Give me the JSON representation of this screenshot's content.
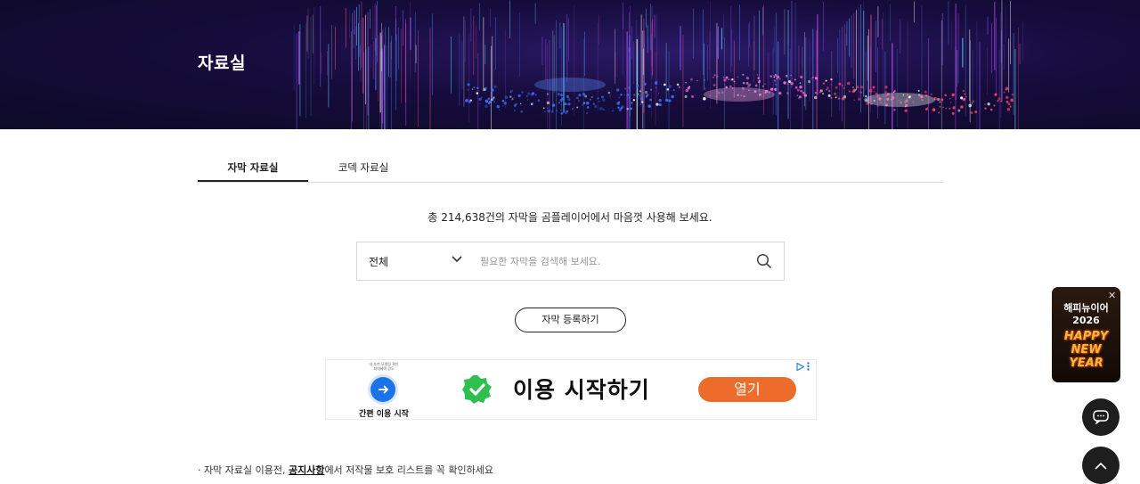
{
  "hero": {
    "title": "자료실"
  },
  "tabs": [
    {
      "label": "자막 자료실",
      "active": true
    },
    {
      "label": "코덱 자료실",
      "active": false
    }
  ],
  "summary": {
    "text": "총 214,638건의 자막을 곰플레이어에서 마음껏 사용해 보세요."
  },
  "search": {
    "category_value": "전체",
    "placeholder": "필요한 자막을 검색해 보세요.",
    "value": ""
  },
  "register_button": {
    "label": "자막 등록하기"
  },
  "ad": {
    "small_text_1": "내 추천 모델링 확인",
    "small_text_2": "최대혜택 경도",
    "sub_label": "간편 이용 시작",
    "headline": "이용 시작하기",
    "open_label": "열기",
    "accent_color": "#ee6c2b",
    "badge_color": "#2fbf4f"
  },
  "notice": {
    "prefix": "· 자막 자료실 이용전, ",
    "link": "공지사항",
    "suffix": "에서 저작물 보호 리스트를 꼭 확인하세요"
  },
  "promo": {
    "title_line1": "해피뉴이어",
    "title_line2": "2026",
    "art_line1": "HAPPY",
    "art_line2": "NEW",
    "art_line3": "YEAR"
  },
  "icons": {
    "search": "search-icon",
    "dropdown": "chevron-down-icon",
    "chat": "chat-icon",
    "top": "chevron-up-icon",
    "close": "close-icon"
  }
}
